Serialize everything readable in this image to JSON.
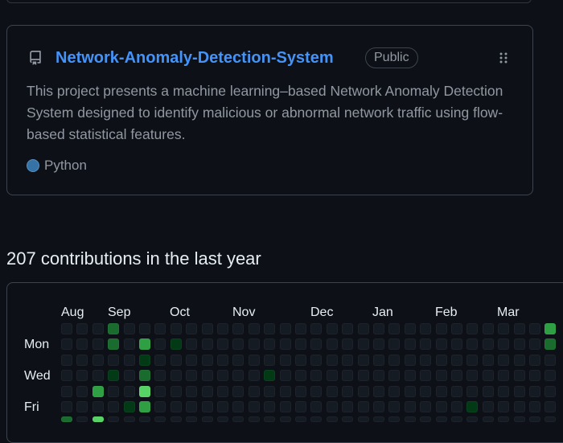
{
  "repo": {
    "name": "Network-Anomaly-Detection-System",
    "visibility": "Public",
    "description": "This project presents a machine learning–based Network Anomaly Detection System designed to identify malicious or abnormal network traffic using flow-based statistical features.",
    "language": "Python",
    "language_color": "#3572A5",
    "icon": "repo-icon"
  },
  "contributions": {
    "title": "207 contributions in the last year",
    "months": [
      "Aug",
      "Sep",
      "Oct",
      "Nov",
      "Dec",
      "Jan",
      "Feb",
      "Mar"
    ],
    "day_labels": [
      "Mon",
      "Wed",
      "Fri"
    ],
    "level_colors": [
      "#151b23",
      "#033a16",
      "#196c2e",
      "#2ea043",
      "#56d364"
    ],
    "active_cells": [
      {
        "week": 3,
        "day": 0,
        "level": 2
      },
      {
        "week": 3,
        "day": 1,
        "level": 2
      },
      {
        "week": 3,
        "day": 3,
        "level": 1
      },
      {
        "week": 2,
        "day": 4,
        "level": 3
      },
      {
        "week": 2,
        "day": 6,
        "level": 4
      },
      {
        "week": 4,
        "day": 5,
        "level": 1
      },
      {
        "week": 5,
        "day": 1,
        "level": 3
      },
      {
        "week": 5,
        "day": 2,
        "level": 1
      },
      {
        "week": 5,
        "day": 3,
        "level": 2
      },
      {
        "week": 5,
        "day": 4,
        "level": 4
      },
      {
        "week": 5,
        "day": 5,
        "level": 3
      },
      {
        "week": 7,
        "day": 1,
        "level": 1
      },
      {
        "week": 13,
        "day": 3,
        "level": 1
      },
      {
        "week": 0,
        "day": 6,
        "level": 2
      },
      {
        "week": 26,
        "day": 5,
        "level": 1
      },
      {
        "week": 31,
        "day": 0,
        "level": 3
      },
      {
        "week": 31,
        "day": 1,
        "level": 2
      }
    ]
  }
}
